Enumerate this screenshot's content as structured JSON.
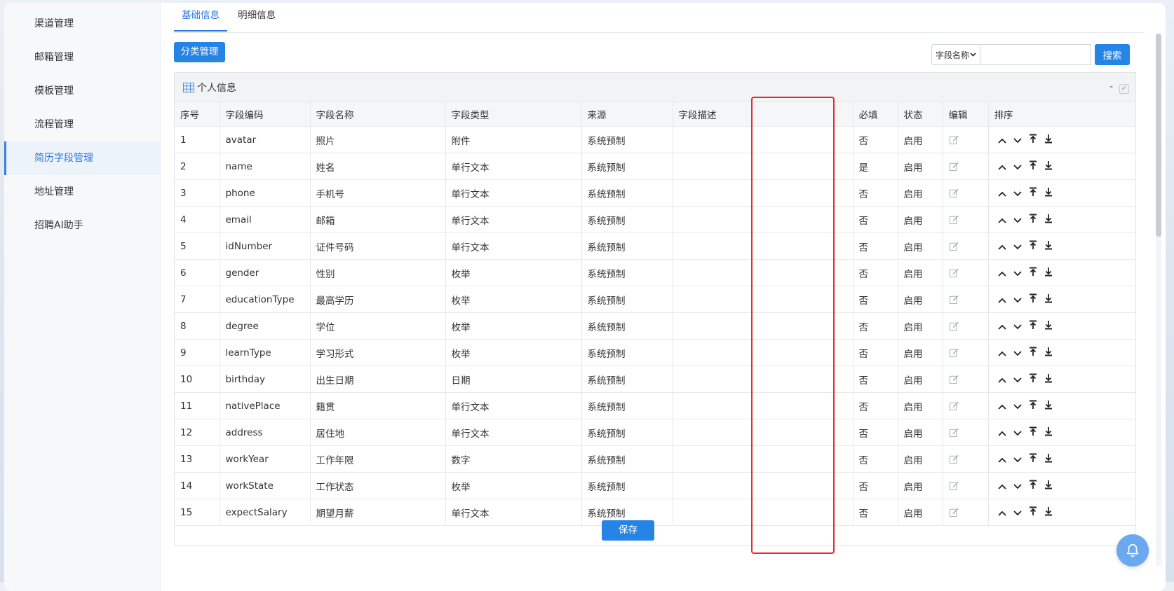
{
  "sidebar": {
    "items": [
      {
        "label": "渠道管理"
      },
      {
        "label": "邮箱管理"
      },
      {
        "label": "模板管理"
      },
      {
        "label": "流程管理"
      },
      {
        "label": "简历字段管理"
      },
      {
        "label": "地址管理"
      },
      {
        "label": "招聘AI助手"
      }
    ],
    "active_index": 4
  },
  "tabs": [
    {
      "label": "基础信息",
      "active": true
    },
    {
      "label": "明细信息",
      "active": false
    }
  ],
  "toolbar": {
    "category_button": "分类管理",
    "search_field_select": "字段名称",
    "search_input_value": "",
    "search_button": "搜索"
  },
  "panel": {
    "title": "个人信息",
    "collapse_label": "-"
  },
  "table": {
    "headers": [
      "序号",
      "字段编码",
      "字段名称",
      "字段类型",
      "来源",
      "字段描述",
      "必填",
      "状态",
      "编辑",
      "排序"
    ],
    "rows": [
      {
        "no": "1",
        "code": "avatar",
        "name": "照片",
        "type": "附件",
        "source": "系统预制",
        "desc": "",
        "required": "否",
        "status": "启用"
      },
      {
        "no": "2",
        "code": "name",
        "name": "姓名",
        "type": "单行文本",
        "source": "系统预制",
        "desc": "",
        "required": "是",
        "status": "启用"
      },
      {
        "no": "3",
        "code": "phone",
        "name": "手机号",
        "type": "单行文本",
        "source": "系统预制",
        "desc": "",
        "required": "否",
        "status": "启用"
      },
      {
        "no": "4",
        "code": "email",
        "name": "邮箱",
        "type": "单行文本",
        "source": "系统预制",
        "desc": "",
        "required": "否",
        "status": "启用"
      },
      {
        "no": "5",
        "code": "idNumber",
        "name": "证件号码",
        "type": "单行文本",
        "source": "系统预制",
        "desc": "",
        "required": "否",
        "status": "启用"
      },
      {
        "no": "6",
        "code": "gender",
        "name": "性别",
        "type": "枚举",
        "source": "系统预制",
        "desc": "",
        "required": "否",
        "status": "启用"
      },
      {
        "no": "7",
        "code": "educationType",
        "name": "最高学历",
        "type": "枚举",
        "source": "系统预制",
        "desc": "",
        "required": "否",
        "status": "启用"
      },
      {
        "no": "8",
        "code": "degree",
        "name": "学位",
        "type": "枚举",
        "source": "系统预制",
        "desc": "",
        "required": "否",
        "status": "启用"
      },
      {
        "no": "9",
        "code": "learnType",
        "name": "学习形式",
        "type": "枚举",
        "source": "系统预制",
        "desc": "",
        "required": "否",
        "status": "启用"
      },
      {
        "no": "10",
        "code": "birthday",
        "name": "出生日期",
        "type": "日期",
        "source": "系统预制",
        "desc": "",
        "required": "否",
        "status": "启用"
      },
      {
        "no": "11",
        "code": "nativePlace",
        "name": "籍贯",
        "type": "单行文本",
        "source": "系统预制",
        "desc": "",
        "required": "否",
        "status": "启用"
      },
      {
        "no": "12",
        "code": "address",
        "name": "居住地",
        "type": "单行文本",
        "source": "系统预制",
        "desc": "",
        "required": "否",
        "status": "启用"
      },
      {
        "no": "13",
        "code": "workYear",
        "name": "工作年限",
        "type": "数字",
        "source": "系统预制",
        "desc": "",
        "required": "否",
        "status": "启用"
      },
      {
        "no": "14",
        "code": "workState",
        "name": "工作状态",
        "type": "枚举",
        "source": "系统预制",
        "desc": "",
        "required": "否",
        "status": "启用"
      },
      {
        "no": "15",
        "code": "expectSalary",
        "name": "期望月薪",
        "type": "单行文本",
        "source": "系统预制",
        "desc": "",
        "required": "否",
        "status": "启用"
      }
    ]
  },
  "footer": {
    "save_button": "保存"
  },
  "icons": {
    "edit": "edit-icon",
    "sort_up": "move-up-icon",
    "sort_down": "move-down-icon",
    "sort_top": "move-to-top-icon",
    "sort_bottom": "move-to-bottom-icon",
    "notification": "bell-icon",
    "grid": "table-grid-icon"
  },
  "colors": {
    "primary": "#2584e6",
    "highlight_border": "#e8292e",
    "active_nav": "#2a77e0"
  }
}
